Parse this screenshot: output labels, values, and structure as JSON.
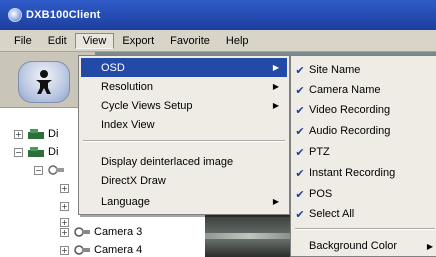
{
  "window": {
    "title": "DXB100Client"
  },
  "menubar": {
    "items": [
      {
        "label": "File"
      },
      {
        "label": "Edit"
      },
      {
        "label": "View"
      },
      {
        "label": "Export"
      },
      {
        "label": "Favorite"
      },
      {
        "label": "Help"
      }
    ]
  },
  "view_menu": {
    "items": [
      {
        "label": "OSD",
        "submenu_arrow": "▶"
      },
      {
        "label": "Resolution",
        "submenu_arrow": "▶"
      },
      {
        "label": "Cycle Views Setup",
        "submenu_arrow": "▶"
      },
      {
        "label": "Index View"
      },
      {
        "label": "Display deinterlaced image"
      },
      {
        "label": "DirectX Draw"
      },
      {
        "label": "Language",
        "submenu_arrow": "▶"
      }
    ]
  },
  "osd_submenu": {
    "check_glyph": "✔",
    "items": [
      {
        "label": "Site Name",
        "checked": true
      },
      {
        "label": "Camera Name",
        "checked": true
      },
      {
        "label": "Video Recording",
        "checked": true
      },
      {
        "label": "Audio Recording",
        "checked": true
      },
      {
        "label": "PTZ",
        "checked": true
      },
      {
        "label": "Instant Recording",
        "checked": true
      },
      {
        "label": "POS",
        "checked": true
      },
      {
        "label": "Select All",
        "checked": true
      },
      {
        "label": "Background Color",
        "submenu_arrow": "▶"
      }
    ]
  },
  "tree": {
    "nodes": [
      {
        "label": "Di",
        "expander": "+"
      },
      {
        "label": "Di",
        "expander": "−"
      },
      {
        "label": "",
        "expander": "−"
      },
      {
        "label": "",
        "expander": "+"
      },
      {
        "label": "",
        "expander": "+"
      },
      {
        "label": "",
        "expander": "+"
      },
      {
        "label": "Camera 3",
        "expander": "+"
      },
      {
        "label": "Camera 4",
        "expander": "+"
      }
    ]
  },
  "icons": {
    "app": "app-logo-icon",
    "toolbar": "person-icon",
    "camera": "camera-icon",
    "dvr": "dvr-icon"
  },
  "colors": {
    "titlebar": "#1c3f9e",
    "highlight": "#244aa8",
    "menu_bg": "#eeece5",
    "check": "#1f3f9e"
  }
}
